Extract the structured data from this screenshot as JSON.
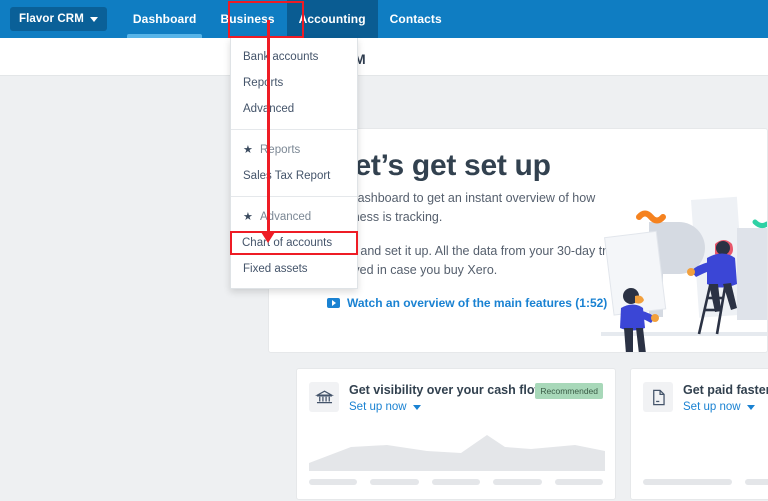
{
  "navbar": {
    "org_button": "Flavor CRM",
    "items": [
      {
        "label": "Dashboard",
        "state": "current"
      },
      {
        "label": "Business",
        "state": "normal"
      },
      {
        "label": "Accounting",
        "state": "open"
      },
      {
        "label": "Contacts",
        "state": "normal"
      }
    ],
    "highlight_color": "#ee1c25",
    "bar_color": "#0f7dc2",
    "active_tab_color": "#0a5c92"
  },
  "page": {
    "title": "Flavor CRM",
    "background": "#eef0f2"
  },
  "dropdown": {
    "groups": [
      {
        "header": null,
        "items": [
          "Bank accounts",
          "Reports",
          "Advanced"
        ]
      },
      {
        "header": "Reports",
        "items": [
          "Sales Tax Report"
        ]
      },
      {
        "header": "Advanced",
        "items": [
          "Chart of accounts",
          "Fixed assets"
        ]
      }
    ],
    "selected_item": "Chart of accounts",
    "star_glyph": "★"
  },
  "hero": {
    "title": "Hi, let’s get set up",
    "paragraph_1": "Use this dashboard to get an instant overview of how your business is tracking.",
    "paragraph_2": "Go ahead and set it up. All the data from your 30-day trial will be saved in case you buy Xero.",
    "video_link": "Watch an overview of the main features (1:52)",
    "link_color": "#1a82d2"
  },
  "cards": [
    {
      "icon": "bank-icon",
      "title": "Get visibility over your cash flow",
      "action": "Set up now",
      "badge": "Recommended",
      "placeholder": "area-chart"
    },
    {
      "icon": "invoice-icon",
      "title": "Get paid faster with online invoicing",
      "action": "Set up now",
      "badge": null,
      "placeholder": "blocks"
    }
  ]
}
